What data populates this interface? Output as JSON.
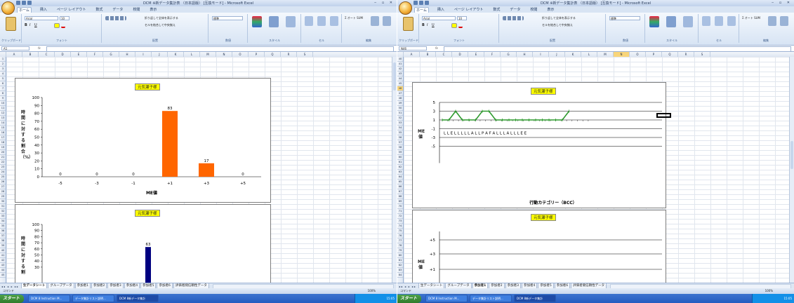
{
  "left": {
    "title": "DCM ※新データ集計表 （日本語版） [互換モード] - Microsoft Excel",
    "tabs": [
      "ホーム",
      "挿入",
      "ページ レイアウト",
      "数式",
      "データ",
      "校閲",
      "表示"
    ],
    "font_name": "Arial",
    "font_size": "10",
    "ribbon_labels": {
      "clipboard": "クリップボード",
      "font": "フォント",
      "alignment": "配置",
      "number": "数値",
      "style": "スタイル",
      "cells": "セル",
      "edit": "編集"
    },
    "wrap_text": "折り返して全体を表示する",
    "merge_center": "セルを結合して中央揃え",
    "number_format": "標準",
    "sum_label": "Σ オート SUM",
    "namebox": "A1",
    "columns": [
      "A",
      "B",
      "C",
      "D",
      "E",
      "F",
      "G",
      "H",
      "I",
      "J",
      "K",
      "L",
      "M",
      "N",
      "O",
      "P",
      "Q",
      "R",
      "S"
    ],
    "rows": [
      "1",
      "2",
      "3",
      "4",
      "5",
      "6",
      "7",
      "8",
      "9",
      "10",
      "11",
      "12",
      "13",
      "14",
      "15",
      "16",
      "17",
      "18",
      "19",
      "20",
      "21",
      "22",
      "23",
      "24",
      "25",
      "26",
      "27",
      "28",
      "29",
      "30",
      "31",
      "32",
      "33",
      "34",
      "35",
      "36",
      "37",
      "38",
      "39",
      "40",
      "41",
      "42",
      "43",
      "44",
      "45"
    ],
    "sheet_tabs": [
      "生データシート",
      "グループデータ",
      "参加者1",
      "参加者2",
      "参加者3",
      "参加者4",
      "参加者5",
      "参加者6",
      "評価者間信頼性データ"
    ],
    "active_tab": "生データシート",
    "status_left": "コマンド",
    "zoom": "100%",
    "start": "スタート",
    "tasks": [
      "DCM 8 Instruction M...",
      "データ集計リスト説明...",
      "DCM 8新データ集計"
    ],
    "tray_time": "15:05"
  },
  "right": {
    "title": "DCM ※新データ集計表 （日本語版） [互換モード] - Microsoft Excel",
    "tabs": [
      "ホーム",
      "挿入",
      "ページ レイアウト",
      "数式",
      "データ",
      "校閲",
      "表示"
    ],
    "font_name": "Arial",
    "font_size": "10",
    "ribbon_labels": {
      "clipboard": "クリップボード",
      "font": "フォント",
      "alignment": "配置",
      "number": "数値",
      "style": "スタイル",
      "cells": "セル",
      "edit": "編集"
    },
    "wrap_text": "折り返して全体を表示する",
    "merge_center": "セルを結合して中央揃え",
    "number_format": "標準",
    "sum_label": "Σ オート SUM",
    "namebox": "N46",
    "columns": [
      "A",
      "B",
      "C",
      "D",
      "E",
      "F",
      "G",
      "H",
      "I",
      "J",
      "K",
      "L",
      "M",
      "N",
      "O",
      "P",
      "Q",
      "R",
      "S"
    ],
    "rows": [
      "40",
      "41",
      "42",
      "43",
      "44",
      "45",
      "46",
      "47",
      "48",
      "49",
      "50",
      "51",
      "52",
      "53",
      "54",
      "55",
      "56",
      "57",
      "58",
      "59",
      "60",
      "61",
      "62",
      "63",
      "64",
      "65",
      "66",
      "67",
      "68",
      "69",
      "70",
      "71",
      "72",
      "73",
      "74",
      "75",
      "76",
      "77",
      "78",
      "79",
      "80",
      "81",
      "82",
      "83",
      "84"
    ],
    "sheet_tabs": [
      "生データシート",
      "グループデータ",
      "参加者1",
      "参加者2",
      "参加者3",
      "参加者4",
      "参加者5",
      "参加者6",
      "評価者間信頼性データ"
    ],
    "active_tab": "参加者1",
    "status_left": "コマンド",
    "zoom": "100%",
    "start": "スタート",
    "tasks": [
      "DCM 8 Instruction M...",
      "データ集計リスト説明...",
      "DCM 8新データ集計"
    ],
    "tray_time": "15:05"
  },
  "chart_data": [
    {
      "type": "bar",
      "title": "元気瀬子様",
      "xlabel": "ME値",
      "ylabel": "時間に対する割合（%）",
      "categories": [
        "-5",
        "-3",
        "-1",
        "+1",
        "+3",
        "+5"
      ],
      "values": [
        0,
        0,
        0,
        83,
        17,
        0
      ],
      "yticks": [
        "0",
        "10",
        "20",
        "30",
        "40",
        "50",
        "60",
        "70",
        "80",
        "90",
        "100"
      ],
      "ylim": [
        0,
        100
      ],
      "color": "#ff6600"
    },
    {
      "type": "bar",
      "title": "元気瀬子様",
      "xlabel": "",
      "ylabel": "時間に対する割",
      "visible_value_label": "63",
      "values": [
        63
      ],
      "yticks": [
        "30",
        "40",
        "50",
        "60",
        "70",
        "80",
        "90",
        "100"
      ],
      "ylim": [
        0,
        100
      ],
      "color": "#000080"
    },
    {
      "type": "line",
      "title": "元気瀬子様",
      "xlabel": "行動カテゴリー（BCC）",
      "ylabel": "ME値",
      "yticks": [
        "5",
        "3",
        "1",
        "-1",
        "-3",
        "-5"
      ],
      "values": [
        1,
        1,
        3,
        1,
        1,
        1,
        3,
        3,
        1,
        1,
        1,
        1,
        1,
        1,
        1,
        1,
        1,
        1,
        1,
        3
      ],
      "categories": [
        "L",
        "L",
        "E",
        "L",
        "L",
        "L",
        "L",
        "L",
        "A",
        "L",
        "L",
        "P",
        "A",
        "F",
        "A",
        "L",
        "L",
        "L",
        "A",
        "L",
        "L",
        "L",
        "E",
        "E"
      ],
      "category_text": "L L E L L L L L A L L P A F A L L L A L L L E E",
      "color": "#2e9a2e"
    },
    {
      "type": "line",
      "title": "元気瀬子様",
      "ylabel": "ME値",
      "yticks": [
        "+5",
        "+3",
        "+1"
      ],
      "values": []
    }
  ]
}
